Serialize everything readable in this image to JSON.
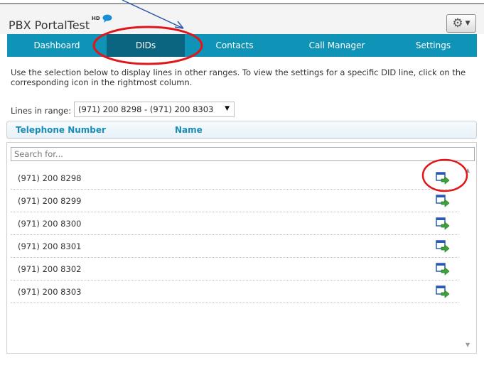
{
  "app": {
    "title": "PBX PortalTest",
    "badge": "HD",
    "settings_icon": "gear-icon",
    "chat_icon": "speech-bubble-icon"
  },
  "nav": {
    "tabs": [
      {
        "label": "Dashboard"
      },
      {
        "label": "DIDs",
        "active": true
      },
      {
        "label": "Contacts"
      },
      {
        "label": "Call Manager"
      },
      {
        "label": "Settings"
      }
    ]
  },
  "main": {
    "description": "Use the selection below to display lines in other ranges. To view the settings for a specific DID line, click on the corresponding icon in the rightmost column.",
    "range_label": "Lines in range:",
    "range_value": "(971) 200 8298 - (971) 200 8303",
    "columns": {
      "phone": "Telephone Number",
      "name": "Name"
    },
    "search_placeholder": "Search for...",
    "row_icon": "open-settings-icon",
    "rows": [
      {
        "phone": "(971) 200 8298"
      },
      {
        "phone": "(971) 200 8299"
      },
      {
        "phone": "(971) 200 8300"
      },
      {
        "phone": "(971) 200 8301"
      },
      {
        "phone": "(971) 200 8302"
      },
      {
        "phone": "(971) 200 8303"
      }
    ]
  },
  "colors": {
    "nav_bg": "#0f93b6",
    "nav_active": "#0c6580",
    "header_text": "#1a8cb5",
    "annotation_circle": "#e0161b",
    "annotation_arrow": "#2f5aa8"
  }
}
